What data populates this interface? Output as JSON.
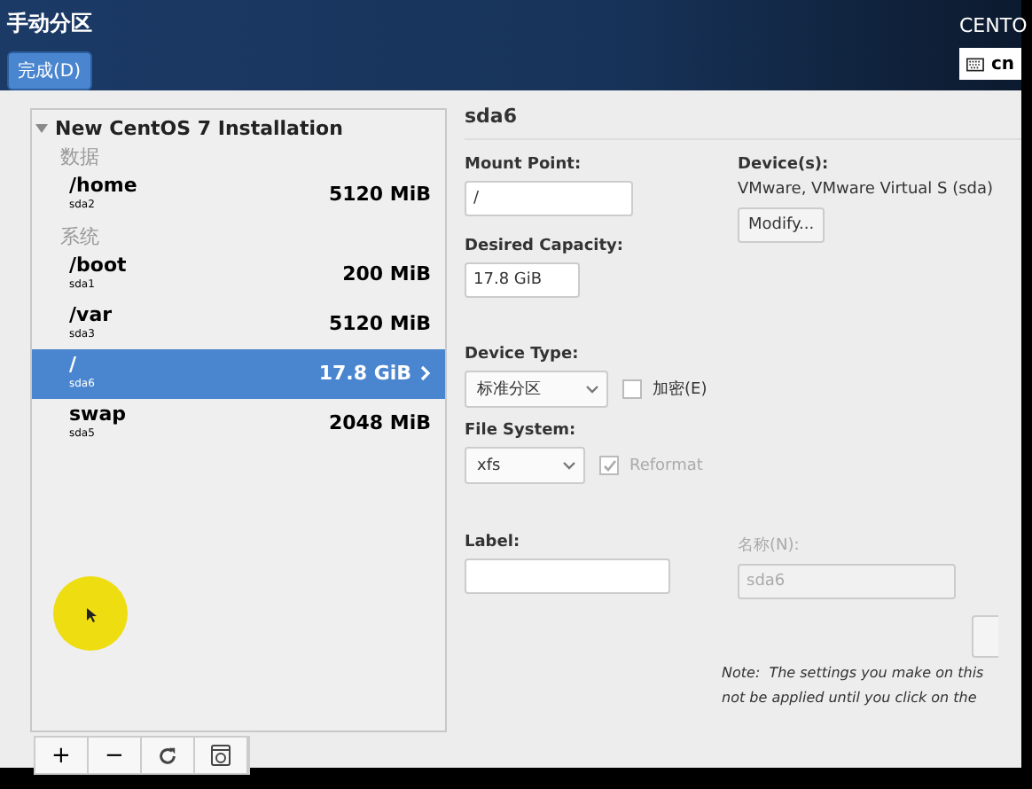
{
  "header": {
    "title": "手动分区",
    "done_button": "完成(D)",
    "product": "CENTO",
    "keyboard": "cn"
  },
  "tree": {
    "root": {
      "label": "New CentOS 7 Installation",
      "expanded": true
    },
    "groups": [
      {
        "label": "数据",
        "items": [
          {
            "mount": "/home",
            "device": "sda2",
            "size": "5120 MiB",
            "selected": false
          }
        ]
      },
      {
        "label": "系统",
        "items": [
          {
            "mount": "/boot",
            "device": "sda1",
            "size": "200 MiB",
            "selected": false
          },
          {
            "mount": "/var",
            "device": "sda3",
            "size": "5120 MiB",
            "selected": false
          },
          {
            "mount": "/",
            "device": "sda6",
            "size": "17.8 GiB",
            "selected": true
          },
          {
            "mount": "swap",
            "device": "sda5",
            "size": "2048 MiB",
            "selected": false
          }
        ]
      }
    ]
  },
  "toolbar": [
    {
      "kind": "add",
      "label": "+"
    },
    {
      "kind": "remove",
      "label": "−"
    },
    {
      "kind": "refresh"
    },
    {
      "kind": "configure"
    }
  ],
  "detail": {
    "title": "sda6",
    "mount_point": {
      "label": "Mount Point:",
      "value": "/"
    },
    "capacity": {
      "label": "Desired Capacity:",
      "value": "17.8 GiB"
    },
    "devices": {
      "label": "Device(s):",
      "value": "VMware, VMware Virtual S (sda)",
      "button": "Modify..."
    },
    "device_type": {
      "label": "Device Type:",
      "value": "标准分区"
    },
    "encrypt": {
      "label": "加密(E)",
      "checked": false
    },
    "file_system": {
      "label": "File System:",
      "value": "xfs"
    },
    "reformat": {
      "label": "Reformat",
      "checked": true,
      "disabled": true
    },
    "label_field": {
      "label": "Label:"
    },
    "name_field": {
      "label": "名称(N):",
      "value": "sda6",
      "disabled": true
    },
    "note": [
      "Note:  The settings you make on this",
      "not be applied until you click on the"
    ]
  }
}
